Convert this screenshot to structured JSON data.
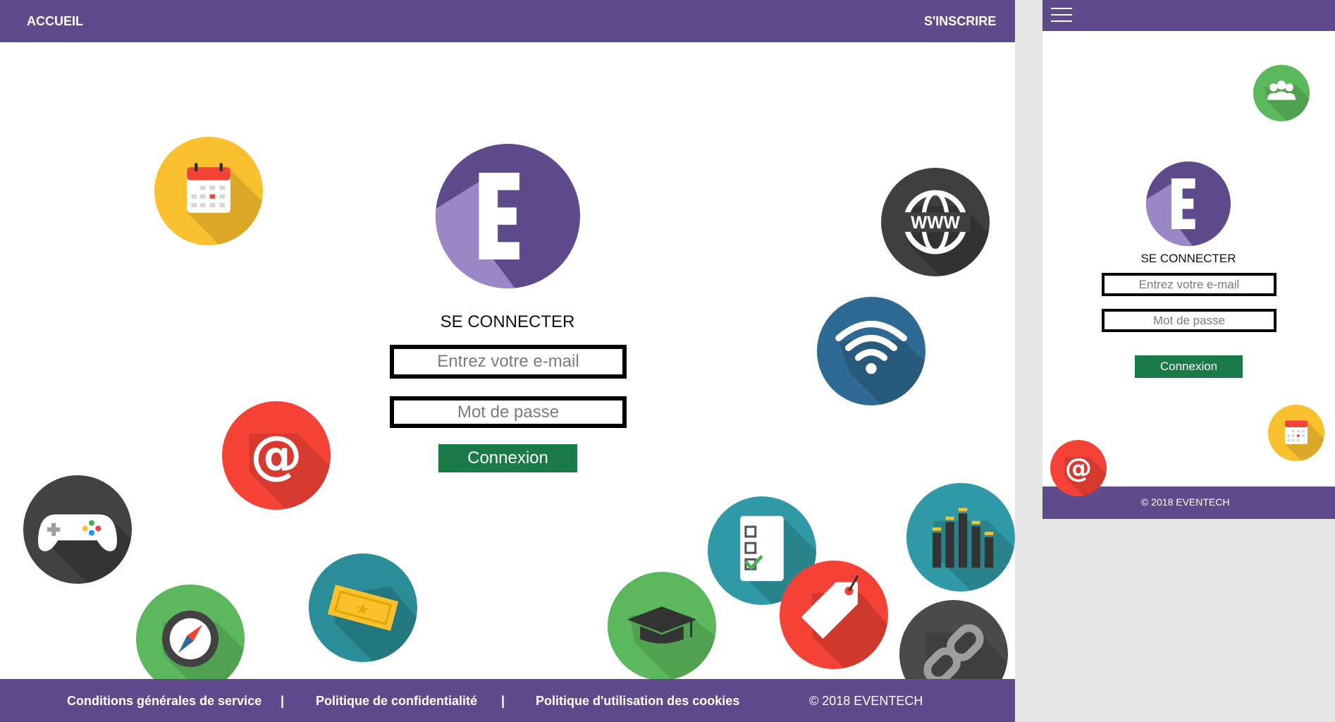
{
  "desktop": {
    "nav": {
      "home": "ACCUEIL",
      "signup": "S'INSCRIRE"
    },
    "login": {
      "title": "SE CONNECTER",
      "email_placeholder": "Entrez votre e-mail",
      "password_placeholder": "Mot de passe",
      "submit": "Connexion"
    },
    "footer": {
      "terms": "Conditions générales de service",
      "sep": "|",
      "privacy": "Politique de confidentialité",
      "cookies": "Politique d'utilisation des cookies",
      "copyright": "© 2018 EVENTECH"
    }
  },
  "mobile": {
    "login": {
      "title": "SE CONNECTER",
      "email_placeholder": "Entrez votre e-mail",
      "password_placeholder": "Mot de passe",
      "submit": "Connexion"
    },
    "footer": {
      "copyright": "© 2018 EVENTECH"
    }
  },
  "logo": {
    "letter": "E"
  },
  "icons": {
    "www_text": "WWW"
  },
  "colors": {
    "brand_purple": "#5f4b8b",
    "logo_light": "#9b87c5",
    "button_green": "#1a7a48",
    "calendar_yellow": "#fbc02d",
    "www_dark": "#3f3f3f",
    "wifi_blue": "#2f6a95",
    "email_red": "#f44336",
    "gamepad_dark": "#424242",
    "compass_green": "#5cb85c",
    "ticket_teal": "#2a8d97",
    "cap_green": "#5cb85c",
    "checklist_teal": "#2f9aa5",
    "tag_red": "#f44336",
    "link_dark": "#4a4a4a",
    "equalizer_teal": "#2f9aa5",
    "people_green": "#5cb85c"
  }
}
